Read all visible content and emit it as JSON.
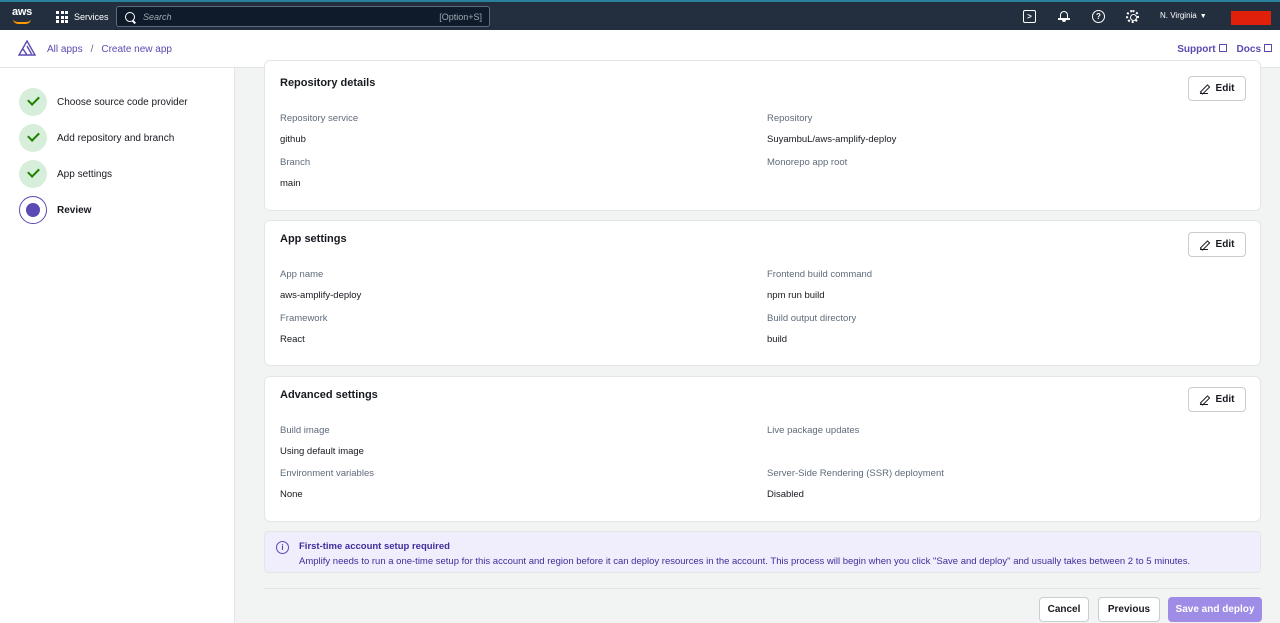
{
  "topnav": {
    "logo_text": "aws",
    "services_label": "Services",
    "search_placeholder": "Search",
    "search_shortcut": "[Option+S]",
    "region": "N. Virginia"
  },
  "breadcrumb": {
    "items": [
      "All apps",
      "Create new app"
    ],
    "separator": "/",
    "support_label": "Support",
    "docs_label": "Docs"
  },
  "wizard": {
    "steps": [
      {
        "label": "Choose source code provider",
        "state": "complete"
      },
      {
        "label": "Add repository and branch",
        "state": "complete"
      },
      {
        "label": "App settings",
        "state": "complete"
      },
      {
        "label": "Review",
        "state": "current"
      }
    ]
  },
  "sections": {
    "repository": {
      "title": "Repository details",
      "edit_label": "Edit",
      "fields": [
        {
          "label": "Repository service",
          "value": "github"
        },
        {
          "label": "Repository",
          "value": "SuyambuL/aws-amplify-deploy"
        },
        {
          "label": "Branch",
          "value": "main"
        },
        {
          "label": "Monorepo app root",
          "value": ""
        }
      ]
    },
    "app_settings": {
      "title": "App settings",
      "edit_label": "Edit",
      "fields": [
        {
          "label": "App name",
          "value": "aws-amplify-deploy"
        },
        {
          "label": "Frontend build command",
          "value": "npm run build"
        },
        {
          "label": "Framework",
          "value": "React"
        },
        {
          "label": "Build output directory",
          "value": "build"
        }
      ]
    },
    "advanced": {
      "title": "Advanced settings",
      "edit_label": "Edit",
      "fields": [
        {
          "label": "Build image",
          "value": "Using default image"
        },
        {
          "label": "Live package updates",
          "value": ""
        },
        {
          "label": "Environment variables",
          "value": "None"
        },
        {
          "label": "Server-Side Rendering (SSR) deployment",
          "value": "Disabled"
        }
      ]
    }
  },
  "banner": {
    "title": "First-time account setup required",
    "description": "Amplify needs to run a one-time setup for this account and region before it can deploy resources in the account. This process will begin when you click \"Save and deploy\" and usually takes between 2 to 5 minutes."
  },
  "actions": {
    "cancel": "Cancel",
    "previous": "Previous",
    "save": "Save and deploy"
  },
  "colors": {
    "nav_bg": "#232f3e",
    "accent": "#5c49b3",
    "primary_button": "#9f8ce6",
    "success": "#1d8102"
  }
}
